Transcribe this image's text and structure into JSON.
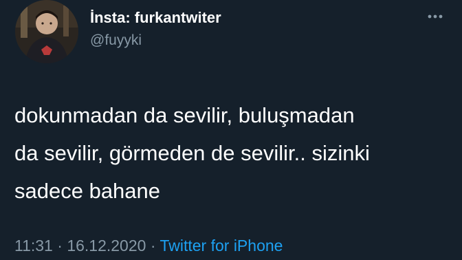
{
  "user": {
    "display_name": "İnsta: furkantwiter",
    "handle": "@fuyyki",
    "avatar_icon": "profile-photo"
  },
  "menu": {
    "icon": "more-horizontal-icon"
  },
  "tweet": {
    "lines": [
      "dokunmadan da sevilir, buluşmadan",
      "da sevilir, görmeden de sevilir.. sizinki",
      "sadece bahane"
    ]
  },
  "meta": {
    "time": "11:31",
    "separator1": " · ",
    "date": "16.12.2020",
    "separator2": " · ",
    "source": "Twitter for iPhone"
  },
  "colors": {
    "background": "#15202b",
    "text": "#ffffff",
    "secondary": "#8899a6",
    "accent": "#1da1f2"
  }
}
